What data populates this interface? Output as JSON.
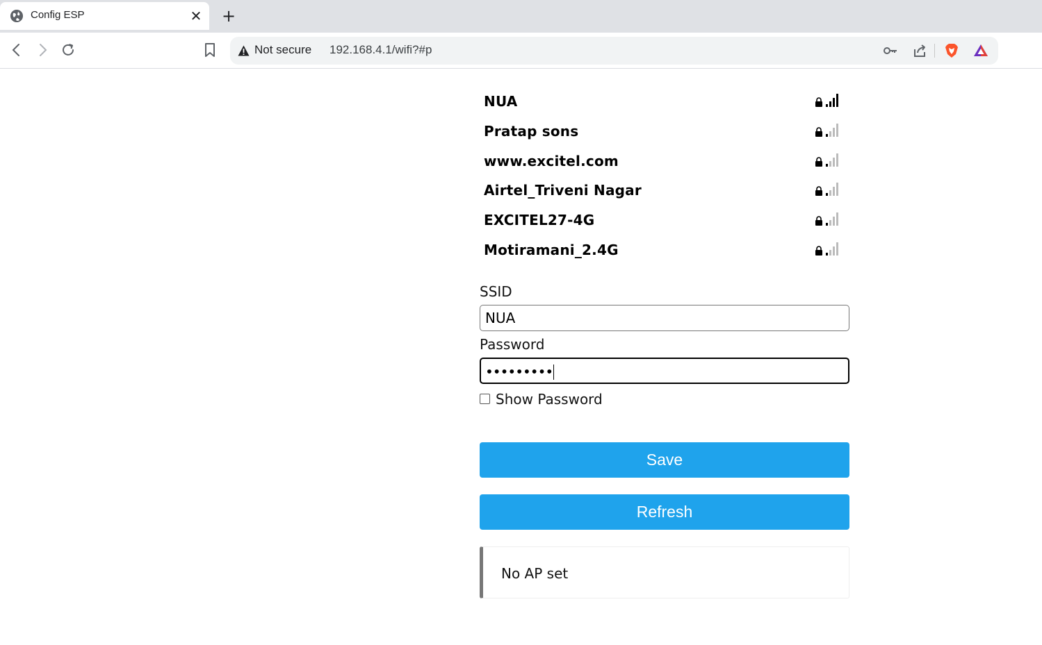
{
  "browser": {
    "tab_title": "Config ESP",
    "security_label": "Not secure",
    "url": "192.168.4.1/wifi?#p"
  },
  "networks": [
    {
      "ssid": "NUA",
      "secured": true,
      "signal": 4
    },
    {
      "ssid": "Pratap sons",
      "secured": true,
      "signal": 1
    },
    {
      "ssid": "www.excitel.com",
      "secured": true,
      "signal": 1
    },
    {
      "ssid": "Airtel_Triveni Nagar",
      "secured": true,
      "signal": 1
    },
    {
      "ssid": "EXCITEL27-4G",
      "secured": true,
      "signal": 1
    },
    {
      "ssid": "Motiramani_2.4G",
      "secured": true,
      "signal": 1
    }
  ],
  "form": {
    "ssid_label": "SSID",
    "ssid_value": "NUA",
    "password_label": "Password",
    "password_masked": "•••••••••",
    "show_password_label": "Show Password",
    "show_password_checked": false,
    "save_label": "Save",
    "refresh_label": "Refresh"
  },
  "status": {
    "message": "No AP set"
  },
  "colors": {
    "button": "#1fa3ec",
    "signal_on": "#000000",
    "signal_off": "#bbbbbb"
  }
}
